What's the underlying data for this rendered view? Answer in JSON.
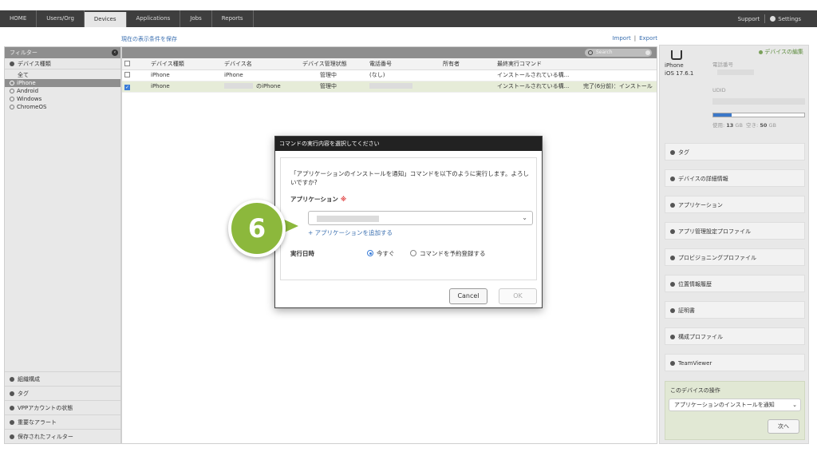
{
  "nav": {
    "items": [
      "HOME",
      "Users/Org",
      "Devices",
      "Applications",
      "Jobs",
      "Reports"
    ],
    "active": "Devices",
    "support": "Support",
    "settings": "Settings"
  },
  "links": {
    "save_filter": "現在の表示条件を保存",
    "import": "Import",
    "sep": "|",
    "export": "Export"
  },
  "sidebar": {
    "filter_title": "フィルター",
    "device_type": "デバイス種類",
    "tree": [
      "全て",
      "iPhone",
      "Android",
      "Windows",
      "ChromeOS"
    ],
    "selected": "iPhone",
    "bottom": [
      "組織構成",
      "タグ",
      "VPPアカウントの状態",
      "重要なアラート",
      "保存されたフィルター"
    ]
  },
  "table": {
    "search_placeholder": "Search",
    "headers": [
      "デバイス種類",
      "デバイス名",
      "デバイス管理状態",
      "電話番号",
      "所有者",
      "最終実行コマンド",
      ""
    ],
    "rows": [
      {
        "type": "iPhone",
        "name": "iPhone",
        "status": "管理中",
        "phone": "(なし)",
        "owner": "",
        "last_cmd": "インストールされている構...",
        "result": ""
      },
      {
        "type": "iPhone",
        "name": "のiPhone",
        "status": "管理中",
        "phone": "",
        "owner": "",
        "last_cmd": "インストールされている構...",
        "result": "完了(6分前)：インストール"
      }
    ]
  },
  "right": {
    "edit": "デバイスの編集",
    "model": "iPhone",
    "os": "iOS 17.6.1",
    "phone_label": "電話番号",
    "udid_label": "UDID",
    "storage_fraction": 0.2,
    "used_label": "使用:",
    "used_value": "13",
    "free_label": "空き:",
    "free_value": "50",
    "unit": "GB",
    "sections": [
      "タグ",
      "デバイスの詳細情報",
      "アプリケーション",
      "アプリ管理設定プロファイル",
      "プロビジョニングプロファイル",
      "位置情報履歴",
      "証明書",
      "構成プロファイル",
      "TeamViewer"
    ],
    "ops_title": "このデバイスの操作",
    "ops_selected": "アプリケーションのインストールを通知",
    "next": "次へ"
  },
  "modal": {
    "title": "コマンドの実行内容を選択してください",
    "message": "「アプリケーションのインストールを通知」コマンドを以下のように実行します。よろしいですか?",
    "app_label": "アプリケーション",
    "required_mark": "※",
    "add_app": "+ アプリケーションを追加する",
    "exec_label": "実行日時",
    "opt_now": "今すぐ",
    "opt_schedule": "コマンドを予約登録する",
    "cancel": "Cancel",
    "ok": "OK"
  },
  "step_badge": "6",
  "colors": {
    "nav_bg": "#3e3e3e",
    "badge": "#8cb83c",
    "link": "#3a6fb0",
    "selection": "#e6ecd8"
  }
}
